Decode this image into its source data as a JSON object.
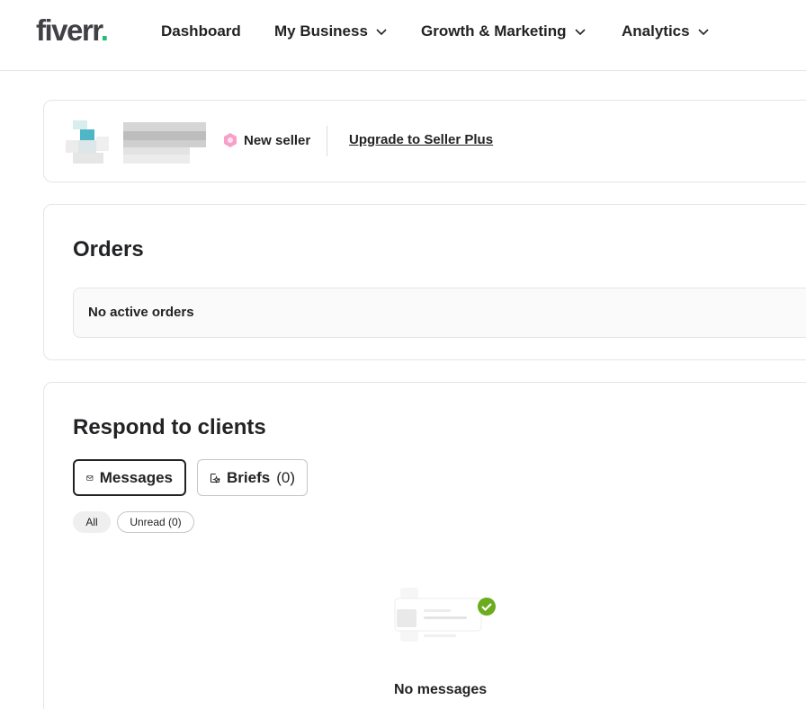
{
  "header": {
    "logo_text": "fiverr",
    "logo_dot": ".",
    "nav": [
      {
        "label": "Dashboard"
      },
      {
        "label": "My Business"
      },
      {
        "label": "Growth & Marketing"
      },
      {
        "label": "Analytics"
      }
    ]
  },
  "profile": {
    "badge_label": "New seller",
    "upgrade_link": "Upgrade to Seller Plus"
  },
  "orders": {
    "title": "Orders",
    "empty_text": "No active orders"
  },
  "clients": {
    "title": "Respond to clients",
    "tabs": [
      {
        "label": "Messages"
      },
      {
        "label": "Briefs",
        "count": "(0)"
      }
    ],
    "filters": [
      {
        "label": "All"
      },
      {
        "label": "Unread (0)"
      }
    ],
    "empty_text": "No messages"
  },
  "colors": {
    "brand_green": "#1dbf73",
    "check_green": "#6bab1e",
    "badge_pink": "#f7a1c8",
    "text": "#222325"
  }
}
